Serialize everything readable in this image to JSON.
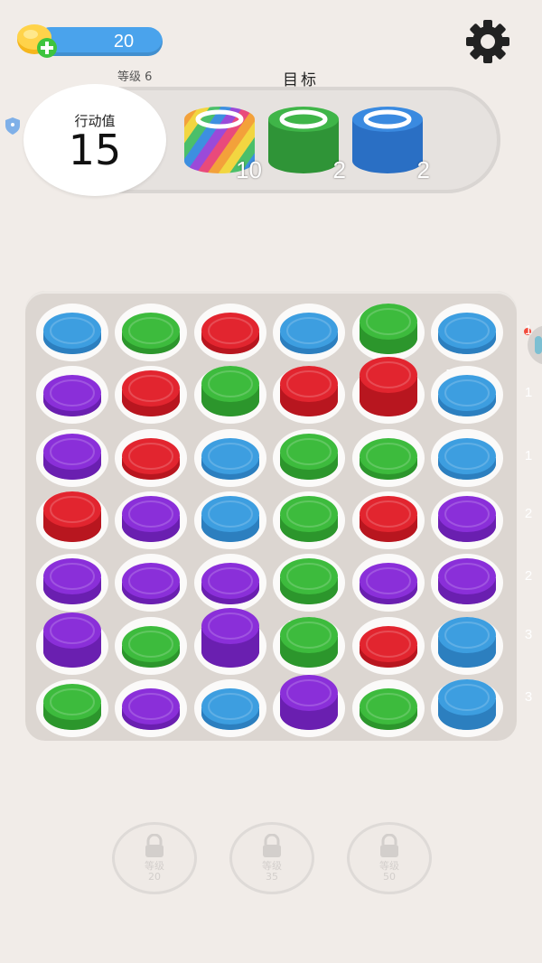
{
  "header": {
    "coins": "20",
    "level_label": "等级 6",
    "goal_label": "目标"
  },
  "moves": {
    "title": "行动值",
    "value": "15"
  },
  "goals": [
    {
      "color": "rainbow",
      "count": "10"
    },
    {
      "color": "#3aa043",
      "count": "2"
    },
    {
      "color": "#2f7bd0",
      "count": "2"
    }
  ],
  "colors": {
    "blue": "#3d9ee0",
    "green": "#3dbb3d",
    "red": "#e2252f",
    "purple": "#8a2fd9",
    "coin_bar": "#4aa3ec",
    "background": "#f1ece8"
  },
  "board": [
    [
      {
        "c": "blue",
        "n": "1",
        "h": 1
      },
      {
        "c": "green",
        "n": "1",
        "h": 1
      },
      {
        "c": "red",
        "n": "1",
        "h": 1
      },
      {
        "c": "blue",
        "n": "1",
        "h": 1
      },
      {
        "c": "green",
        "n": "3",
        "h": 3
      },
      {
        "c": "blue",
        "n": "1",
        "h": 1
      }
    ],
    [
      {
        "c": "purple",
        "n": "1",
        "h": 1
      },
      {
        "c": "red",
        "n": "2",
        "h": 2
      },
      {
        "c": "green",
        "n": "3",
        "h": 3
      },
      {
        "c": "red",
        "n": "3",
        "h": 3
      },
      {
        "c": "red",
        "n": "5",
        "h": 5
      },
      {
        "c": "blue",
        "n": "1",
        "h": 1
      }
    ],
    [
      {
        "c": "purple",
        "n": "2",
        "h": 2
      },
      {
        "c": "red",
        "n": "1",
        "h": 1
      },
      {
        "c": "blue",
        "n": "1",
        "h": 1
      },
      {
        "c": "green",
        "n": "2",
        "h": 2
      },
      {
        "c": "green",
        "n": "1",
        "h": 1
      },
      {
        "c": "blue",
        "n": "1",
        "h": 1
      }
    ],
    [
      {
        "c": "red",
        "n": "3",
        "h": 3
      },
      {
        "c": "purple",
        "n": "2",
        "h": 2
      },
      {
        "c": "blue",
        "n": "2",
        "h": 2
      },
      {
        "c": "green",
        "n": "2",
        "h": 2
      },
      {
        "c": "red",
        "n": "2",
        "h": 2
      },
      {
        "c": "purple",
        "n": "2",
        "h": 2
      }
    ],
    [
      {
        "c": "purple",
        "n": "2",
        "h": 2
      },
      {
        "c": "purple",
        "n": "1",
        "h": 1
      },
      {
        "c": "purple",
        "n": "1",
        "h": 1
      },
      {
        "c": "green",
        "n": "2",
        "h": 2
      },
      {
        "c": "purple",
        "n": "1",
        "h": 1
      },
      {
        "c": "purple",
        "n": "2",
        "h": 2
      }
    ],
    [
      {
        "c": "purple",
        "n": "4",
        "h": 4
      },
      {
        "c": "green",
        "n": "1",
        "h": 1
      },
      {
        "c": "purple",
        "n": "5",
        "h": 5
      },
      {
        "c": "green",
        "n": "3",
        "h": 3
      },
      {
        "c": "red",
        "n": "1",
        "h": 1
      },
      {
        "c": "blue",
        "n": "3",
        "h": 3
      }
    ],
    [
      {
        "c": "green",
        "n": "2",
        "h": 2
      },
      {
        "c": "purple",
        "n": "1",
        "h": 1
      },
      {
        "c": "blue",
        "n": "1",
        "h": 1
      },
      {
        "c": "purple",
        "n": "4",
        "h": 4
      },
      {
        "c": "green",
        "n": "1",
        "h": 1
      },
      {
        "c": "blue",
        "n": "3",
        "h": 3
      }
    ]
  ],
  "locked_slots": [
    {
      "label": "等级",
      "level": "20"
    },
    {
      "label": "等级",
      "level": "35"
    },
    {
      "label": "等级",
      "level": "50"
    }
  ]
}
